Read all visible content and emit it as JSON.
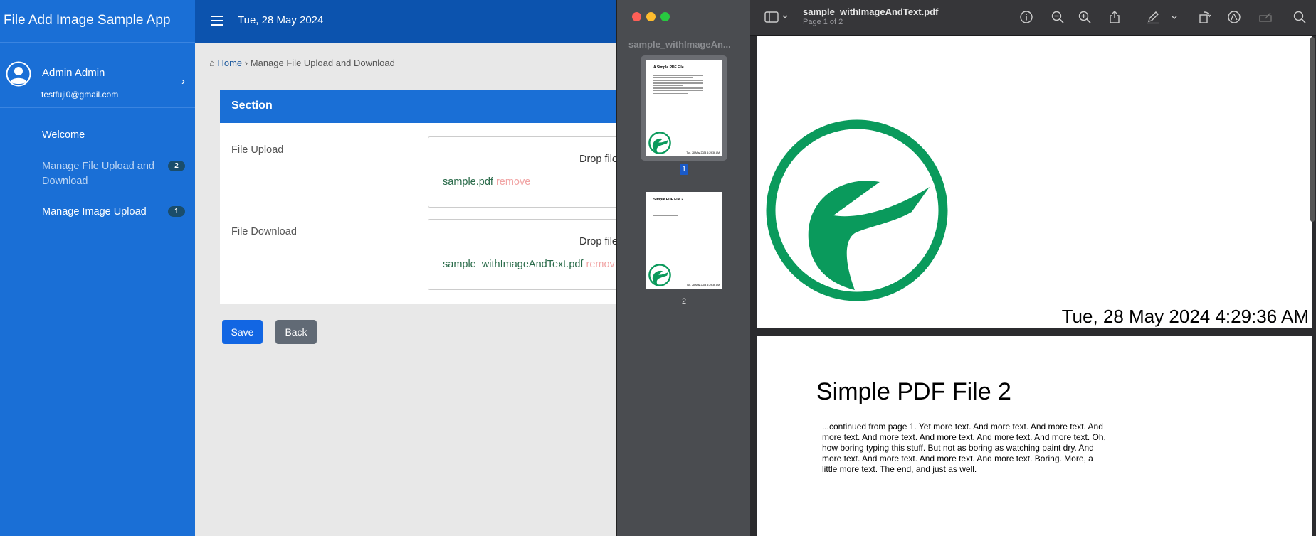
{
  "app": {
    "brand": "File Add Image Sample App",
    "topbar_date": "Tue, 28 May 2024",
    "user": {
      "name": "Admin Admin",
      "email": "testfuji0@gmail.com"
    },
    "nav": {
      "welcome": "Welcome",
      "file_upload": "Manage File Upload and Download",
      "file_upload_badge": "2",
      "image_upload": "Manage Image Upload",
      "image_upload_badge": "1"
    },
    "breadcrumb": {
      "home": "Home",
      "separator": "›",
      "current": "Manage File Upload and Download"
    },
    "section": {
      "title": "Section",
      "upload_label": "File Upload",
      "download_label": "File Download",
      "drop_hint": "Drop file",
      "upload_file": "sample.pdf",
      "download_file": "sample_withImageAndText.pdf",
      "remove_label": "remove",
      "remove_label_clipped": "remov"
    },
    "buttons": {
      "save": "Save",
      "back": "Back"
    },
    "colors": {
      "sidebar": "#1a6fd6",
      "topbar": "#0c53ae",
      "primary": "#1266e3",
      "secondary": "#616a75"
    }
  },
  "preview": {
    "sidebar_title": "sample_withImageAn...",
    "doc_title": "sample_withImageAndText.pdf",
    "page_info": "Page 1 of 2",
    "thumbnails": [
      {
        "num": "1",
        "title": "A Simple PDF File",
        "date": "Tue, 28 May 2024 4:29:36 AM"
      },
      {
        "num": "2",
        "title": "Simple PDF File 2",
        "date": "Tue, 28 May 2024 4:29:36 AM"
      }
    ],
    "toolbar_icons": [
      "sidebar-icon",
      "info-icon",
      "zoom-out-icon",
      "zoom-in-icon",
      "share-icon",
      "markup-pen-icon",
      "chevron-down-icon",
      "rotate-icon",
      "annotate-icon",
      "form-icon",
      "search-icon"
    ],
    "page1_date": "Tue, 28 May 2024 4:29:36 AM",
    "page2_title": "Simple PDF File 2",
    "page2_body": "...continued from page 1. Yet more text. And more text. And more text. And more text. And more text. And more text. And more text. And more text. Oh, how boring typing this stuff. But not as boring as watching paint dry. And more text. And more text. And more text. And more text. Boring.  More, a little more text. The end, and just as well.",
    "logo_color": "#0a9a5c"
  }
}
